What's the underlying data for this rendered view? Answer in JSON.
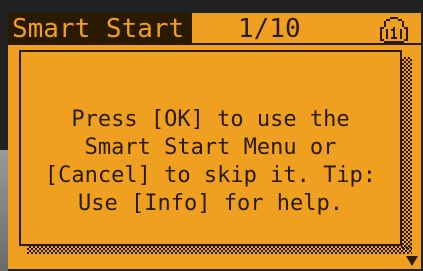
{
  "header": {
    "title": "Smart Start",
    "page": "1/10",
    "help_icon": "help-info-icon"
  },
  "dialog": {
    "lines": [
      "Press [OK] to use the",
      "Smart Start Menu or",
      "[Cancel] to skip it. Tip:",
      "Use [Info] for help."
    ]
  },
  "colors": {
    "screen_bg": "#f0a020",
    "ink": "#2a1a00"
  }
}
